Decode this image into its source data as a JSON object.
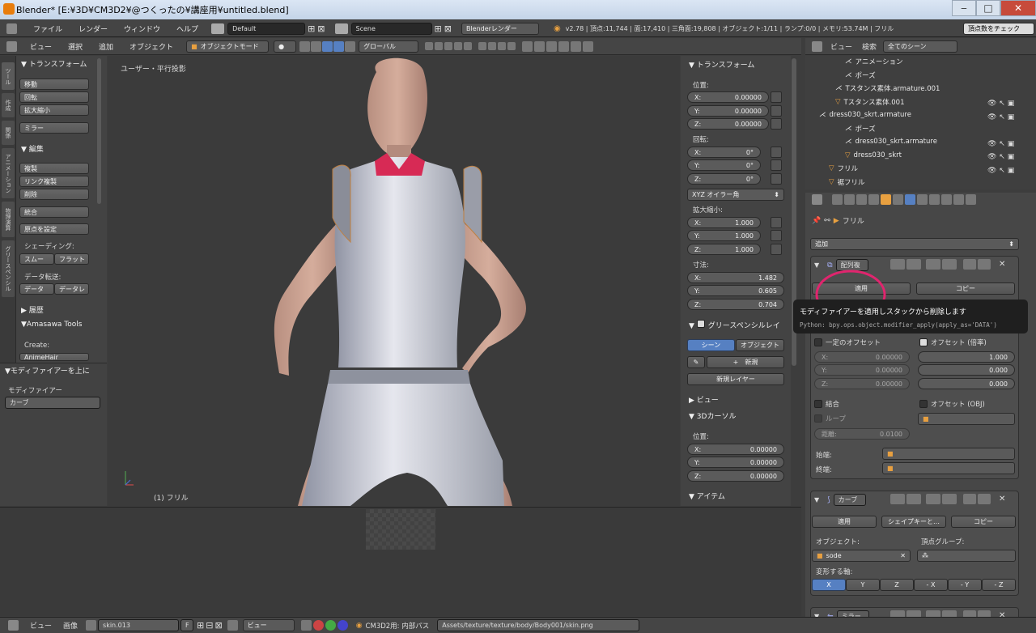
{
  "window": {
    "title": "Blender* [E:¥3D¥CM3D2¥@つくったの¥講座用¥untitled.blend]"
  },
  "topbar": {
    "menus": [
      "ファイル",
      "レンダー",
      "ウィンドウ",
      "ヘルプ"
    ],
    "layout": "Default",
    "scene": "Scene",
    "engine": "Blenderレンダー",
    "stats": "v2.78 | 頂点:11,744 | 面:17,410 | 三角面:19,808 | オブジェクト:1/11 | ランプ:0/0 | メモリ:53.74M | フリル",
    "right_button": "頂点数をチェック"
  },
  "view_header": {
    "menus": [
      "ビュー",
      "選択",
      "追加",
      "オブジェクト"
    ],
    "mode": "オブジェクトモード",
    "orientation": "グローバル"
  },
  "left_panel": {
    "tabs": [
      "ツール",
      "作成",
      "関係",
      "アニメーション",
      "物理演算",
      "グリースペンシル"
    ],
    "transform_header": "トランスフォーム",
    "transform_buttons": [
      "移動",
      "回転",
      "拡大縮小"
    ],
    "mirror": "ミラー",
    "edit_header": "編集",
    "edit_buttons": [
      "複製",
      "リンク複製",
      "削除"
    ],
    "join": "統合",
    "origin": "原点を設定",
    "shading_label": "シェーディング:",
    "shading_buttons": [
      "スムー",
      "フラット"
    ],
    "data_transfer_label": "データ転送:",
    "data_buttons": [
      "データ",
      "データレ"
    ],
    "history": "履歴",
    "amasawa": "Amasawa Tools",
    "create_label": "Create:",
    "anime_hair": "AnimeHair",
    "modifier_up_header": "モディファイアーを上に",
    "modifier_label": "モディファイアー",
    "modifier_value": "カーブ"
  },
  "viewport": {
    "view_label": "ユーザー・平行投影",
    "object_label": "(1) フリル"
  },
  "n_panel": {
    "transform": "トランスフォーム",
    "location": "位置:",
    "loc": [
      {
        "axis": "X:",
        "val": "0.00000"
      },
      {
        "axis": "Y:",
        "val": "0.00000"
      },
      {
        "axis": "Z:",
        "val": "0.00000"
      }
    ],
    "rotation": "回転:",
    "rot": [
      {
        "axis": "X:",
        "val": "0°"
      },
      {
        "axis": "Y:",
        "val": "0°"
      },
      {
        "axis": "Z:",
        "val": "0°"
      }
    ],
    "euler": "XYZ オイラー角",
    "scale": "拡大縮小:",
    "scl": [
      {
        "axis": "X:",
        "val": "1.000"
      },
      {
        "axis": "Y:",
        "val": "1.000"
      },
      {
        "axis": "Z:",
        "val": "1.000"
      }
    ],
    "dimensions": "寸法:",
    "dim": [
      {
        "axis": "X:",
        "val": "1.482"
      },
      {
        "axis": "Y:",
        "val": "0.605"
      },
      {
        "axis": "Z:",
        "val": "0.704"
      }
    ],
    "grease": "グリースペンシルレイ",
    "scene_btn": "シーン",
    "object_btn": "オブジェクト",
    "new_btn": "新規",
    "new_layer": "新規レイヤー",
    "view": "ビュー",
    "cursor": "3Dカーソル",
    "cursor_loc": "位置:",
    "cur": [
      {
        "axis": "X:",
        "val": "0.00000"
      },
      {
        "axis": "Y:",
        "val": "0.00000"
      },
      {
        "axis": "Z:",
        "val": "0.00000"
      }
    ],
    "item": "アイテム"
  },
  "outliner": {
    "menus": [
      "ビュー",
      "検索"
    ],
    "filter": "全てのシーン",
    "rows": [
      "アニメーション",
      "ポーズ",
      "Tスタンス素体.armature.001",
      "Tスタンス素体.001",
      "dress030_skrt.armature",
      "ポーズ",
      "dress030_skrt.armature",
      "dress030_skrt",
      "フリル",
      "裾フリル"
    ]
  },
  "properties": {
    "breadcrumb": "フリル",
    "add_modifier": "追加",
    "array": {
      "name": "配列複",
      "apply": "適用",
      "copy": "コピー",
      "const_offset": "一定のオフセット",
      "rel_offset": "オフセット (倍率)",
      "const": [
        {
          "axis": "X:",
          "val": "0.00000"
        },
        {
          "axis": "Y:",
          "val": "0.00000"
        },
        {
          "axis": "Z:",
          "val": "0.00000"
        }
      ],
      "rel": [
        {
          "axis": "",
          "val": "1.000"
        },
        {
          "axis": "",
          "val": "0.000"
        },
        {
          "axis": "",
          "val": "0.000"
        }
      ],
      "merge": "結合",
      "obj_offset": "オフセット (OBJ)",
      "loop": "ループ",
      "distance": "距離:",
      "distance_val": "0.0100",
      "start": "始端:",
      "end": "終端:"
    },
    "tooltip": {
      "text": "モディファイアーを適用しスタックから削除します",
      "python": "Python: bpy.ops.object.modifier_apply(apply_as='DATA')"
    },
    "curve": {
      "name": "カーブ",
      "apply": "適用",
      "shapekey": "シェイプキーと…",
      "copy": "コピー",
      "object_label": "オブジェクト:",
      "vgroup_label": "頂点グループ:",
      "object_value": "sode",
      "axis_label": "変形する軸:",
      "axes": [
        "X",
        "Y",
        "Z",
        "- X",
        "- Y",
        "- Z"
      ]
    },
    "mirror": {
      "name": "ミラー"
    }
  },
  "statusbar": {
    "menus": [
      "ビュー",
      "画像"
    ],
    "image": "skin.013",
    "f": "F",
    "view": "ビュー",
    "path_label": "CM3D2用: 内部パス",
    "path": "Assets/texture/texture/body/Body001/skin.png"
  },
  "colors": {
    "accent": "#5680c2",
    "highlight_circle": "#e0256e",
    "orange": "#e87d0d"
  }
}
